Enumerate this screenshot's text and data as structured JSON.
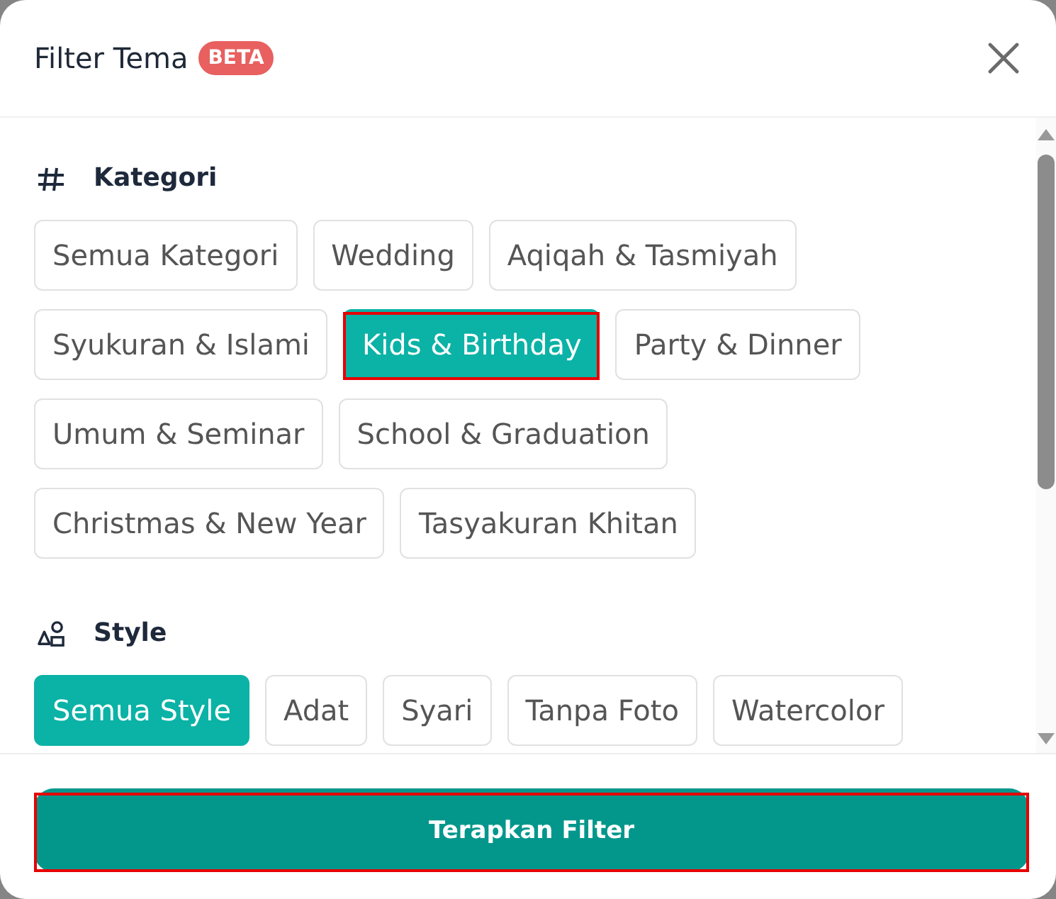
{
  "dialog": {
    "title": "Filter Tema",
    "badge": "BETA"
  },
  "sections": [
    {
      "kind": "category",
      "title": "Kategori",
      "chips": [
        {
          "label": "Semua Kategori",
          "selected": false,
          "highlighted": false
        },
        {
          "label": "Wedding",
          "selected": false,
          "highlighted": false
        },
        {
          "label": "Aqiqah & Tasmiyah",
          "selected": false,
          "highlighted": false
        },
        {
          "label": "Syukuran & Islami",
          "selected": false,
          "highlighted": false
        },
        {
          "label": "Kids & Birthday",
          "selected": true,
          "highlighted": true
        },
        {
          "label": "Party & Dinner",
          "selected": false,
          "highlighted": false
        },
        {
          "label": "Umum & Seminar",
          "selected": false,
          "highlighted": false
        },
        {
          "label": "School & Graduation",
          "selected": false,
          "highlighted": false
        },
        {
          "label": "Christmas & New Year",
          "selected": false,
          "highlighted": false
        },
        {
          "label": "Tasyakuran Khitan",
          "selected": false,
          "highlighted": false
        }
      ]
    },
    {
      "kind": "style",
      "title": "Style",
      "chips": [
        {
          "label": "Semua Style",
          "selected": true,
          "highlighted": false
        },
        {
          "label": "Adat",
          "selected": false,
          "highlighted": false
        },
        {
          "label": "Syari",
          "selected": false,
          "highlighted": false
        },
        {
          "label": "Tanpa Foto",
          "selected": false,
          "highlighted": false
        },
        {
          "label": "Watercolor",
          "selected": false,
          "highlighted": false
        }
      ]
    }
  ],
  "apply_button": {
    "label": "Terapkan Filter",
    "highlighted": true
  }
}
